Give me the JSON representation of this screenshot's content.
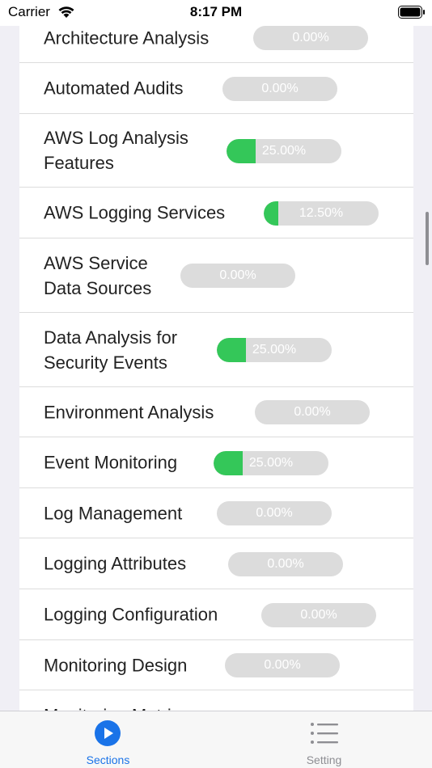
{
  "status": {
    "carrier": "Carrier",
    "time": "8:17 PM"
  },
  "items": [
    {
      "label": "Architecture Analysis",
      "percent": "0.00%",
      "progress": 0.0
    },
    {
      "label": "Automated Audits",
      "percent": "0.00%",
      "progress": 0.0
    },
    {
      "label": "AWS Log Analysis\nFeatures",
      "percent": "25.00%",
      "progress": 0.25
    },
    {
      "label": "AWS Logging Services",
      "percent": "12.50%",
      "progress": 0.125
    },
    {
      "label": "AWS Service\nData Sources",
      "percent": "0.00%",
      "progress": 0.0
    },
    {
      "label": "Data Analysis for\nSecurity Events",
      "percent": "25.00%",
      "progress": 0.25
    },
    {
      "label": "Environment Analysis",
      "percent": "0.00%",
      "progress": 0.0
    },
    {
      "label": "Event Monitoring",
      "percent": "25.00%",
      "progress": 0.25
    },
    {
      "label": "Log Management",
      "percent": "0.00%",
      "progress": 0.0
    },
    {
      "label": "Logging Attributes",
      "percent": "0.00%",
      "progress": 0.0
    },
    {
      "label": "Logging Configuration",
      "percent": "0.00%",
      "progress": 0.0
    },
    {
      "label": "Monitoring Design",
      "percent": "0.00%",
      "progress": 0.0
    },
    {
      "label": "Monitoring Metrics",
      "percent": "",
      "progress": 0.0
    }
  ],
  "tabs": [
    {
      "label": "Sections",
      "icon": "play-circle-icon",
      "selected": true
    },
    {
      "label": "Setting",
      "icon": "list-icon",
      "selected": false
    }
  ],
  "colors": {
    "accent": "#1a73e8",
    "progress": "#34c759",
    "track": "#dcdcdc"
  }
}
